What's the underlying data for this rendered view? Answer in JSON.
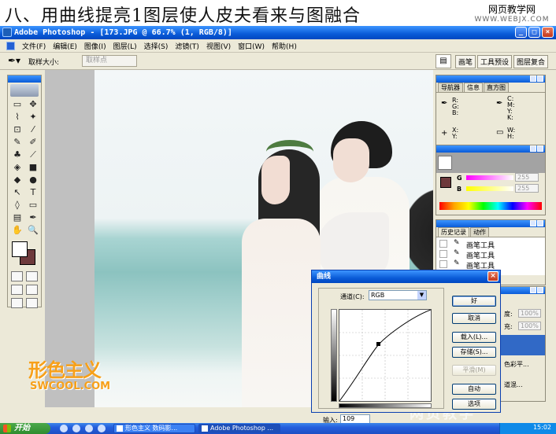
{
  "headline": {
    "title": "八、用曲线提亮1图层使人皮夫看来与图融合",
    "site_cn": "网页教学网",
    "site_en": "WWW.WEBJX.COM"
  },
  "window": {
    "title": "Adobe Photoshop - [173.JPG @ 66.7% (1, RGB/8)]",
    "min": "_",
    "max": "□",
    "close": "×"
  },
  "menubar": [
    "文件(F)",
    "编辑(E)",
    "图像(I)",
    "图层(L)",
    "选择(S)",
    "滤镜(T)",
    "视图(V)",
    "窗口(W)",
    "帮助(H)"
  ],
  "options": {
    "sample_label": "取样大小:",
    "sample_value": "取样点",
    "tabs": [
      "画笔",
      "工具预设",
      "图层复合"
    ]
  },
  "tools": [
    "▭",
    "✥",
    "⌇",
    "✦",
    "⊡",
    "⁄",
    "✎",
    "✐",
    "♣",
    "⟋",
    "◈",
    "■",
    "◆",
    "●",
    "↖",
    "T",
    "◊",
    "▭",
    "▤",
    "✒",
    "✋",
    "🔍"
  ],
  "colors": {
    "foreground": "#ffffff",
    "background": "#6e3a3c"
  },
  "info_panel": {
    "tabs": [
      "导航器",
      "信息",
      "直方图"
    ],
    "rgb": "R:\nG:\nB:",
    "cmyk": "C:\nM:\nY:\nK:",
    "xy": "X:\nY:",
    "wh": "W:\nH:"
  },
  "color_panel": {
    "g_label": "G",
    "g_value": "255",
    "b_label": "B",
    "b_value": "255"
  },
  "history_panel": {
    "tabs": [
      "历史记录",
      "动作"
    ],
    "items": [
      "画笔工具",
      "画笔工具",
      "画笔工具"
    ]
  },
  "layers_fragments": [
    "度:",
    "100%",
    "充:",
    "100%",
    "色彩平...",
    "道混..."
  ],
  "curves_dialog": {
    "title": "曲线",
    "channel_label": "通道(C):",
    "channel_value": "RGB",
    "input_label": "输入:",
    "input_value": "109",
    "buttons": {
      "ok": "好",
      "cancel": "取消",
      "load": "载入(L)...",
      "save": "存储(S)...",
      "smooth": "平滑(M)",
      "auto": "自动",
      "options": "选项"
    }
  },
  "watermark": {
    "logo": "形色主义",
    "domain": "SWCOOL.COM",
    "corner": "网页教学"
  },
  "taskbar": {
    "start": "开始",
    "items": [
      "形色主义 数码影...",
      "Adobe Photoshop ..."
    ],
    "clock": "15:02"
  }
}
